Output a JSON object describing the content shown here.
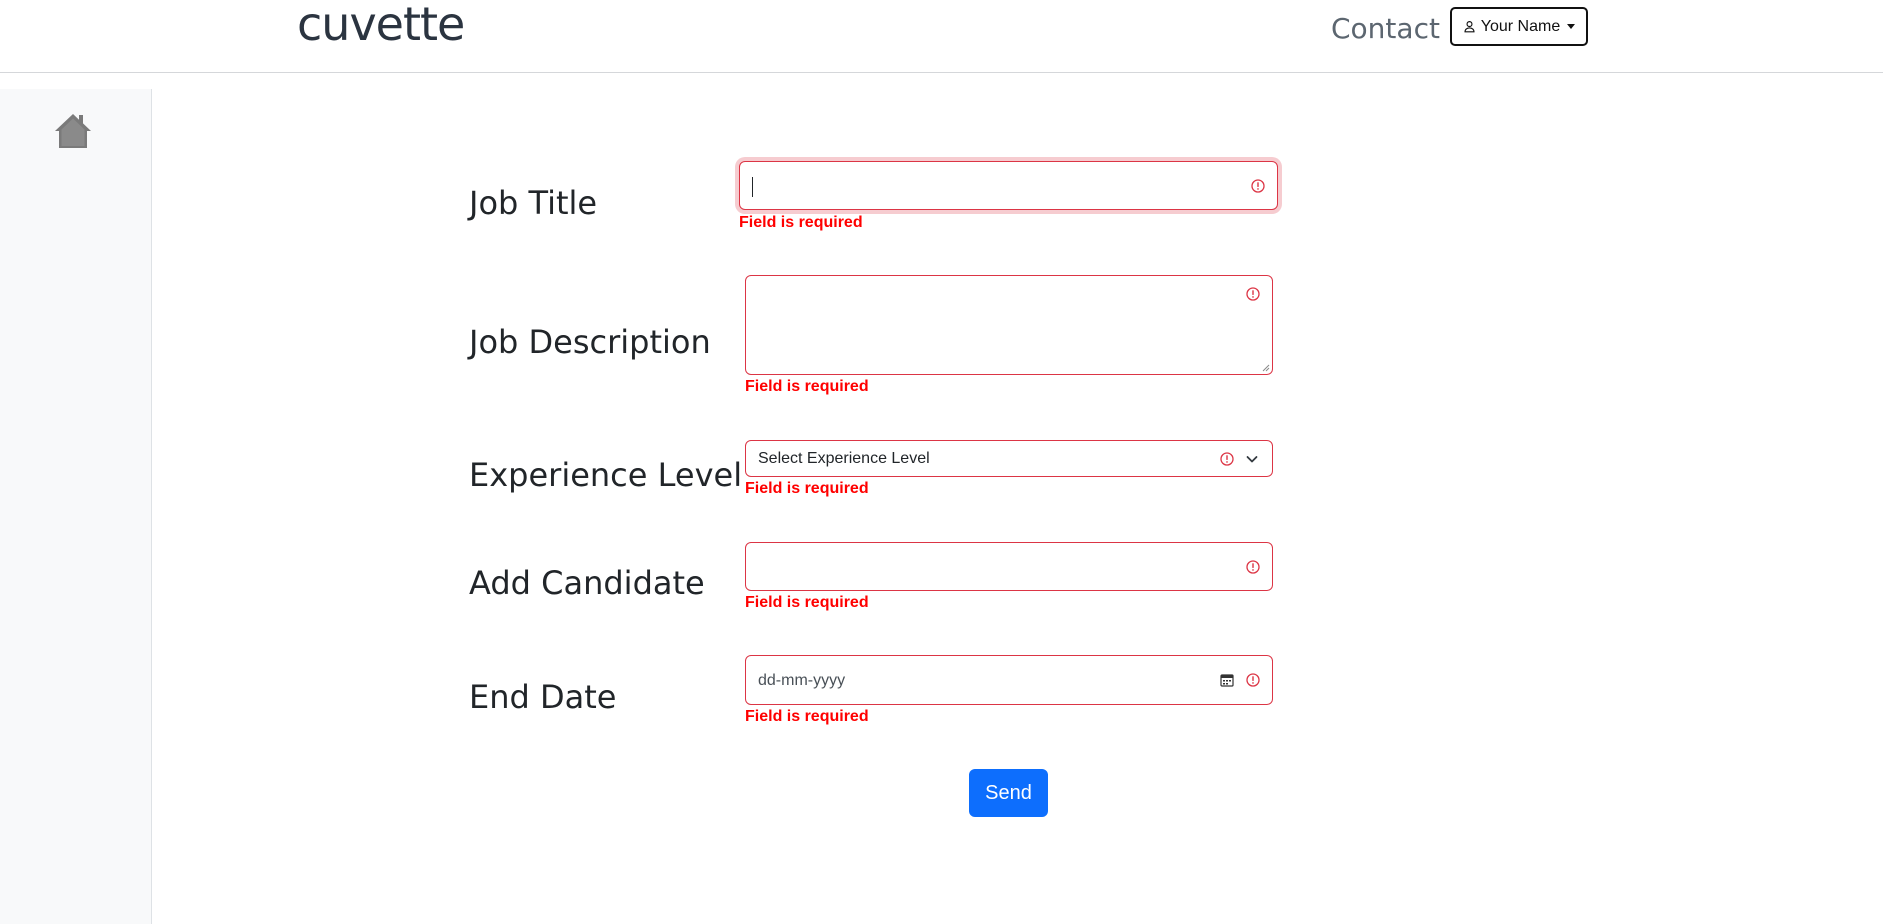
{
  "header": {
    "logo_text": "cuvette",
    "contact_label": "Contact",
    "user_button_label": "Your Name"
  },
  "sidebar": {
    "home_icon": "home-icon"
  },
  "form": {
    "job_title": {
      "label": "Job Title",
      "value": "",
      "error": "Field is required"
    },
    "job_description": {
      "label": "Job Description",
      "value": "",
      "error": "Field is required"
    },
    "experience_level": {
      "label": "Experience Level",
      "selected": "Select Experience Level",
      "error": "Field is required"
    },
    "add_candidate": {
      "label": "Add Candidate",
      "value": "",
      "error": "Field is required"
    },
    "end_date": {
      "label": "End Date",
      "placeholder": "dd-mm-yyyy",
      "error": "Field is required"
    },
    "send_label": "Send"
  },
  "colors": {
    "error": "#dc3545",
    "error_text": "#ff0000",
    "primary": "#0d6efd"
  }
}
